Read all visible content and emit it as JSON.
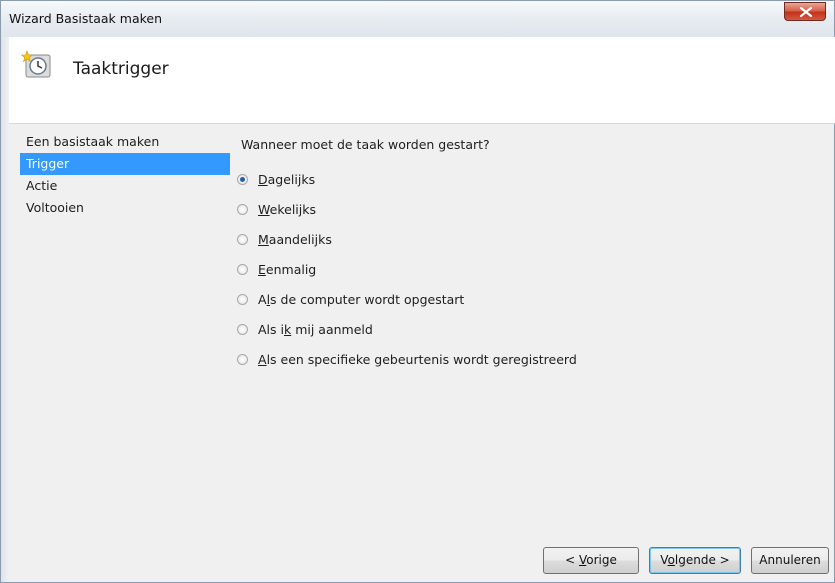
{
  "window": {
    "title": "Wizard Basistaak maken"
  },
  "header": {
    "title": "Taaktrigger",
    "icon": "clock-icon"
  },
  "nav": {
    "items": [
      {
        "label": "Een basistaak maken",
        "selected": false
      },
      {
        "label": "Trigger",
        "selected": true
      },
      {
        "label": "Actie",
        "selected": false
      },
      {
        "label": "Voltooien",
        "selected": false
      }
    ]
  },
  "main": {
    "question": "Wanneer moet de taak worden gestart?",
    "options": [
      {
        "pre": "",
        "key": "D",
        "post": "agelijks",
        "checked": true
      },
      {
        "pre": "",
        "key": "W",
        "post": "ekelijks",
        "checked": false
      },
      {
        "pre": "",
        "key": "M",
        "post": "aandelijks",
        "checked": false
      },
      {
        "pre": "",
        "key": "E",
        "post": "enmalig",
        "checked": false
      },
      {
        "pre": "A",
        "key": "l",
        "post": "s de computer wordt opgestart",
        "checked": false
      },
      {
        "pre": "Als i",
        "key": "k",
        "post": " mij aanmeld",
        "checked": false
      },
      {
        "pre": "",
        "key": "A",
        "post": "ls een specifieke gebeurtenis wordt geregistreerd",
        "checked": false
      }
    ]
  },
  "buttons": {
    "back": {
      "pre": "< ",
      "key": "V",
      "post": "orige"
    },
    "next": {
      "pre": "V",
      "key": "o",
      "post": "lgende >"
    },
    "cancel": {
      "label": "Annuleren"
    }
  },
  "colors": {
    "selection": "#3399ff",
    "close_button": "#c2311b"
  }
}
